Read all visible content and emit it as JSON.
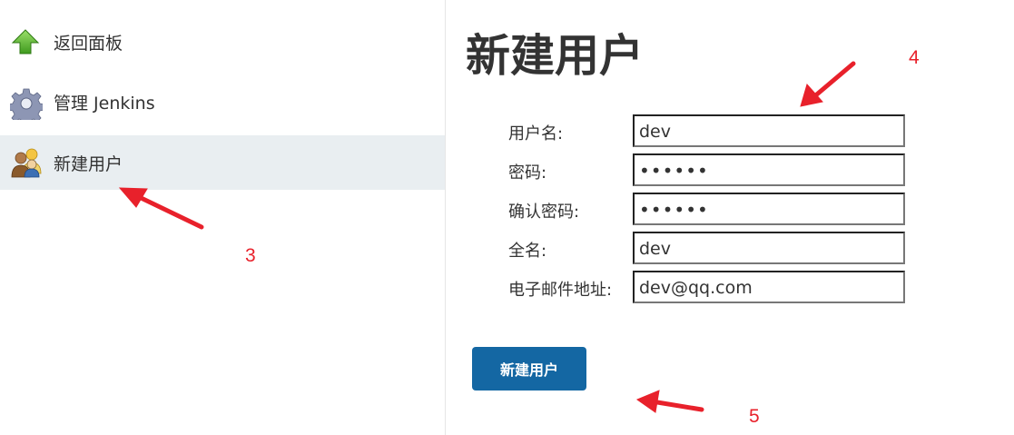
{
  "sidebar": {
    "items": [
      {
        "label": "返回面板",
        "icon": "up-arrow-icon"
      },
      {
        "label": "管理 Jenkins",
        "icon": "gear-icon"
      },
      {
        "label": "新建用户",
        "icon": "users-icon",
        "active": true
      }
    ]
  },
  "main": {
    "title": "新建用户",
    "form": {
      "fields": [
        {
          "label": "用户名:",
          "value": "dev"
        },
        {
          "label": "密码:",
          "value": "••••••"
        },
        {
          "label": "确认密码:",
          "value": "••••••"
        },
        {
          "label": "全名:",
          "value": "dev"
        },
        {
          "label": "电子邮件地址:",
          "value": "dev@qq.com"
        }
      ],
      "submit_label": "新建用户"
    }
  },
  "annotations": {
    "numbers": [
      "3",
      "4",
      "5"
    ],
    "color": "#e8212b"
  },
  "colors": {
    "accent": "#1467a3",
    "active_bg": "#e9eef1"
  }
}
